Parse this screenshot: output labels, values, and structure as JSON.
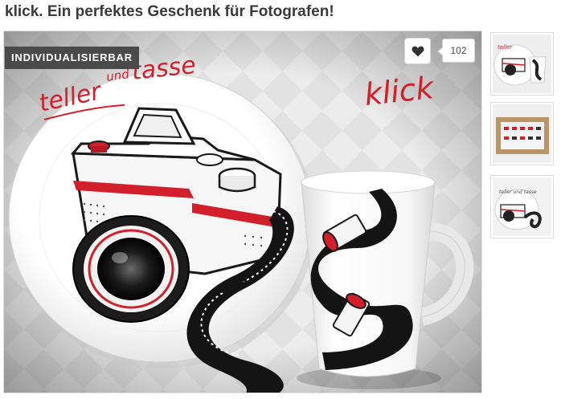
{
  "page": {
    "title": "klick. Ein perfektes Geschenk für Fotografen!"
  },
  "product_image": {
    "badge": "INDIVIDUALISIERBAR",
    "handwriting_teller": "teller",
    "handwriting_und": "und",
    "handwriting_tasse": "tasse",
    "handwriting_klick": "klick",
    "accent_color": "#d11f2b"
  },
  "like": {
    "icon": "heart-icon",
    "count": "102"
  },
  "thumbnails": [
    {
      "name": "thumbnail-plate-mug"
    },
    {
      "name": "thumbnail-gift-box"
    },
    {
      "name": "thumbnail-plate-mug-alt"
    }
  ]
}
